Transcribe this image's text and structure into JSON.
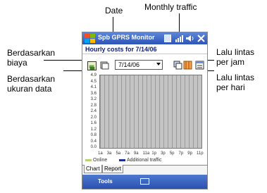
{
  "callouts": {
    "date": "Date",
    "monthly_traffic": "Monthly traffic",
    "by_cost_l1": "Berdasarkan",
    "by_cost_l2": "biaya",
    "by_size_l1": "Berdasarkan",
    "by_size_l2": "ukuran data",
    "per_hour_l1": "Lalu lintas",
    "per_hour_l2": "per jam",
    "per_day_l1": "Lalu lintas",
    "per_day_l2": "per hari"
  },
  "app": {
    "title": "Spb GPRS Monitor",
    "subtitle": "Hourly costs for 7/14/06",
    "date_value": "7/14/06"
  },
  "chart_data": {
    "type": "bar",
    "title": "Hourly costs for 7/14/06",
    "y_ticks": [
      "4.9",
      "4.5",
      "4.1",
      "3.6",
      "3.2",
      "2.8",
      "2.4",
      "2.0",
      "1.6",
      "1.2",
      "0.8",
      "0.4",
      "0.0"
    ],
    "x_ticks": [
      "1a",
      "3a",
      "5a",
      "7a",
      "9a",
      "11a",
      "1p",
      "3p",
      "5p",
      "7p",
      "9p",
      "11p"
    ],
    "series": [
      {
        "name": "Online",
        "color": "#b7d36a"
      },
      {
        "name": "Additional traffic",
        "color": "#1a2f9a"
      }
    ],
    "ylim": [
      0,
      4.9
    ],
    "grid": true
  },
  "tabs": [
    "Chart",
    "Report"
  ],
  "menu": {
    "tools": "Tools"
  }
}
